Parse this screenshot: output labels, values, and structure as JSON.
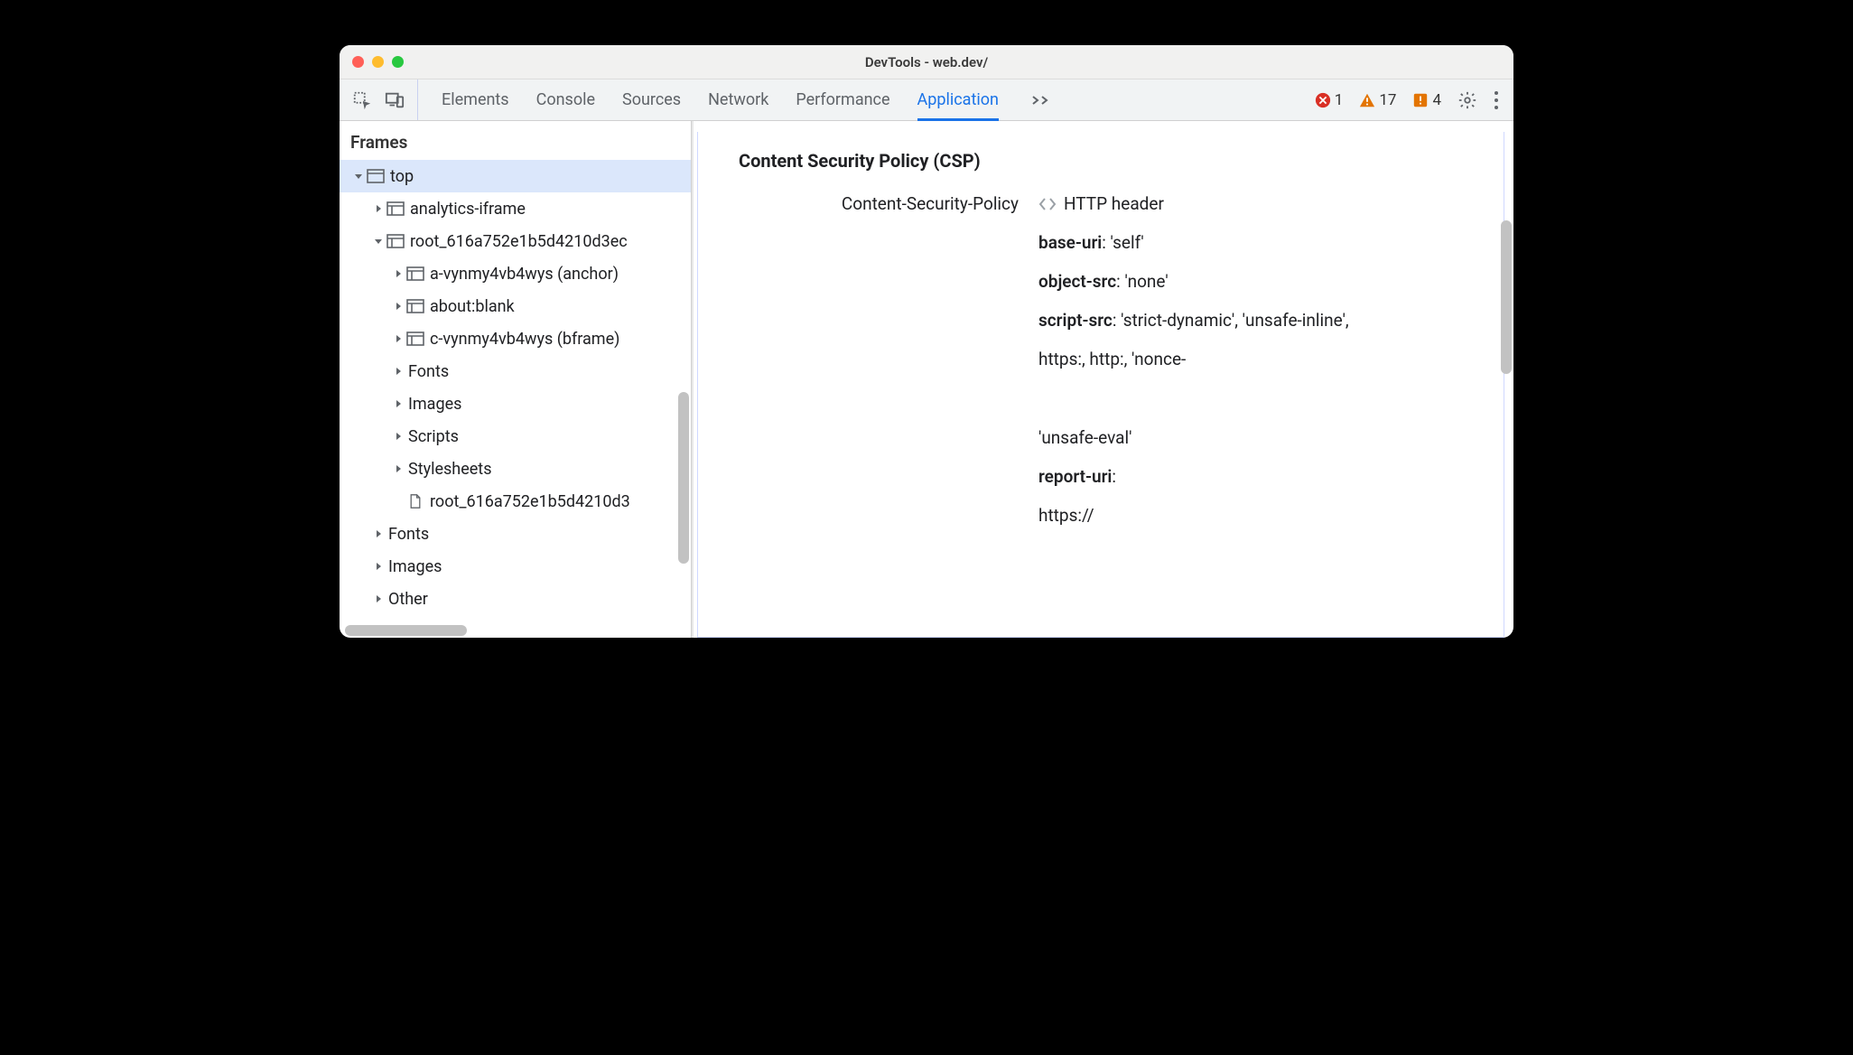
{
  "window": {
    "title": "DevTools - web.dev/"
  },
  "toolbar": {
    "tabs": [
      "Elements",
      "Console",
      "Sources",
      "Network",
      "Performance",
      "Application"
    ],
    "active_tab_index": 5,
    "errors": 1,
    "warnings": 17,
    "issues": 4
  },
  "sidebar": {
    "heading": "Frames",
    "tree": [
      {
        "indent": 1,
        "twisty": "down",
        "icon": "window",
        "label": "top",
        "selected": true
      },
      {
        "indent": 2,
        "twisty": "right",
        "icon": "frame",
        "label": "analytics-iframe"
      },
      {
        "indent": 2,
        "twisty": "down",
        "icon": "frame",
        "label": "root_616a752e1b5d4210d3ec"
      },
      {
        "indent": 3,
        "twisty": "right",
        "icon": "frame",
        "label": "a-vynmy4vb4wys (anchor)"
      },
      {
        "indent": 3,
        "twisty": "right",
        "icon": "frame",
        "label": "about:blank"
      },
      {
        "indent": 3,
        "twisty": "right",
        "icon": "frame",
        "label": "c-vynmy4vb4wys (bframe)"
      },
      {
        "indent": 3,
        "twisty": "right",
        "icon": "",
        "label": "Fonts"
      },
      {
        "indent": 3,
        "twisty": "right",
        "icon": "",
        "label": "Images"
      },
      {
        "indent": 3,
        "twisty": "right",
        "icon": "",
        "label": "Scripts"
      },
      {
        "indent": 3,
        "twisty": "right",
        "icon": "",
        "label": "Stylesheets"
      },
      {
        "indent": 3,
        "twisty": "",
        "icon": "doc",
        "label": "root_616a752e1b5d4210d3"
      },
      {
        "indent": 2,
        "twisty": "right",
        "icon": "",
        "label": "Fonts"
      },
      {
        "indent": 2,
        "twisty": "right",
        "icon": "",
        "label": "Images"
      },
      {
        "indent": 2,
        "twisty": "right",
        "icon": "",
        "label": "Other"
      }
    ]
  },
  "csp": {
    "title": "Content Security Policy (CSP)",
    "header_label": "Content-Security-Policy",
    "header_value": "HTTP header",
    "directives": [
      {
        "name": "base-uri",
        "value": "'self'"
      },
      {
        "name": "object-src",
        "value": "'none'"
      },
      {
        "name": "script-src",
        "value": "'strict-dynamic', 'unsafe-inline',"
      }
    ],
    "extra_lines": [
      "https:, http:, 'nonce-",
      "",
      "'unsafe-eval'"
    ],
    "report_uri_label": "report-uri",
    "report_uri_value": "https://"
  }
}
